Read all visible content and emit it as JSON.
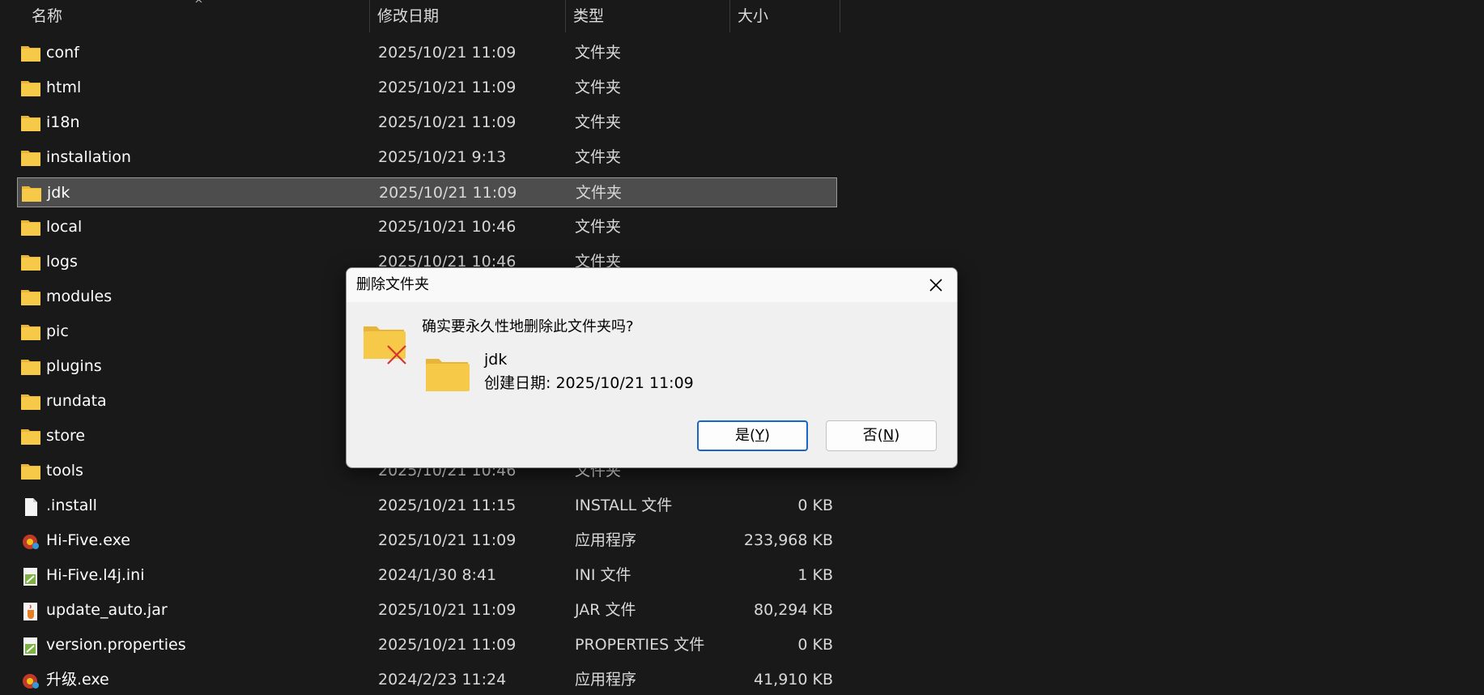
{
  "header": {
    "name": "名称",
    "modified": "修改日期",
    "type": "类型",
    "size": "大小"
  },
  "files": [
    {
      "name": "conf",
      "date": "2025/10/21 11:09",
      "type": "文件夹",
      "size": "",
      "icon": "folder-icon"
    },
    {
      "name": "html",
      "date": "2025/10/21 11:09",
      "type": "文件夹",
      "size": "",
      "icon": "folder-icon"
    },
    {
      "name": "i18n",
      "date": "2025/10/21 11:09",
      "type": "文件夹",
      "size": "",
      "icon": "folder-icon"
    },
    {
      "name": "installation",
      "date": "2025/10/21 9:13",
      "type": "文件夹",
      "size": "",
      "icon": "folder-icon"
    },
    {
      "name": "jdk",
      "date": "2025/10/21 11:09",
      "type": "文件夹",
      "size": "",
      "icon": "folder-icon",
      "selected": true
    },
    {
      "name": "local",
      "date": "2025/10/21 10:46",
      "type": "文件夹",
      "size": "",
      "icon": "folder-icon"
    },
    {
      "name": "logs",
      "date": "2025/10/21 10:46",
      "type": "文件夹",
      "size": "",
      "icon": "folder-icon"
    },
    {
      "name": "modules",
      "date": "",
      "type": "",
      "size": "",
      "icon": "folder-icon"
    },
    {
      "name": "pic",
      "date": "",
      "type": "",
      "size": "",
      "icon": "folder-icon"
    },
    {
      "name": "plugins",
      "date": "",
      "type": "",
      "size": "",
      "icon": "folder-icon"
    },
    {
      "name": "rundata",
      "date": "",
      "type": "",
      "size": "",
      "icon": "folder-icon"
    },
    {
      "name": "store",
      "date": "",
      "type": "",
      "size": "",
      "icon": "folder-icon"
    },
    {
      "name": "tools",
      "date": "2025/10/21 10:46",
      "type": "文件夹",
      "size": "",
      "icon": "folder-icon"
    },
    {
      "name": ".install",
      "date": "2025/10/21 11:15",
      "type": "INSTALL 文件",
      "size": "0 KB",
      "icon": "file-icon"
    },
    {
      "name": "Hi-Five.exe",
      "date": "2025/10/21 11:09",
      "type": "应用程序",
      "size": "233,968 KB",
      "icon": "exe-icon"
    },
    {
      "name": "Hi-Five.l4j.ini",
      "date": "2024/1/30 8:41",
      "type": "INI 文件",
      "size": "1 KB",
      "icon": "ini-icon"
    },
    {
      "name": "update_auto.jar",
      "date": "2025/10/21 11:09",
      "type": "JAR 文件",
      "size": "80,294 KB",
      "icon": "jar-icon"
    },
    {
      "name": "version.properties",
      "date": "2025/10/21 11:09",
      "type": "PROPERTIES 文件",
      "size": "0 KB",
      "icon": "properties-icon"
    },
    {
      "name": "升级.exe",
      "date": "2024/2/23 11:24",
      "type": "应用程序",
      "size": "41,910 KB",
      "icon": "exe-icon"
    }
  ],
  "dialog": {
    "title": "删除文件夹",
    "question": "确实要永久性地删除此文件夹吗?",
    "item_name": "jdk",
    "item_date": "创建日期: 2025/10/21 11:09",
    "yes_label": "是(",
    "yes_key": "Y",
    "yes_suffix": ")",
    "no_label": "否(",
    "no_key": "N",
    "no_suffix": ")"
  },
  "colors": {
    "background": "#191919",
    "selection": "#4d4d4d",
    "folder": "#f7c948",
    "dialog_bg": "#f0f0f0",
    "primary_border": "#1a66c8",
    "delete_x": "#d9362b"
  }
}
